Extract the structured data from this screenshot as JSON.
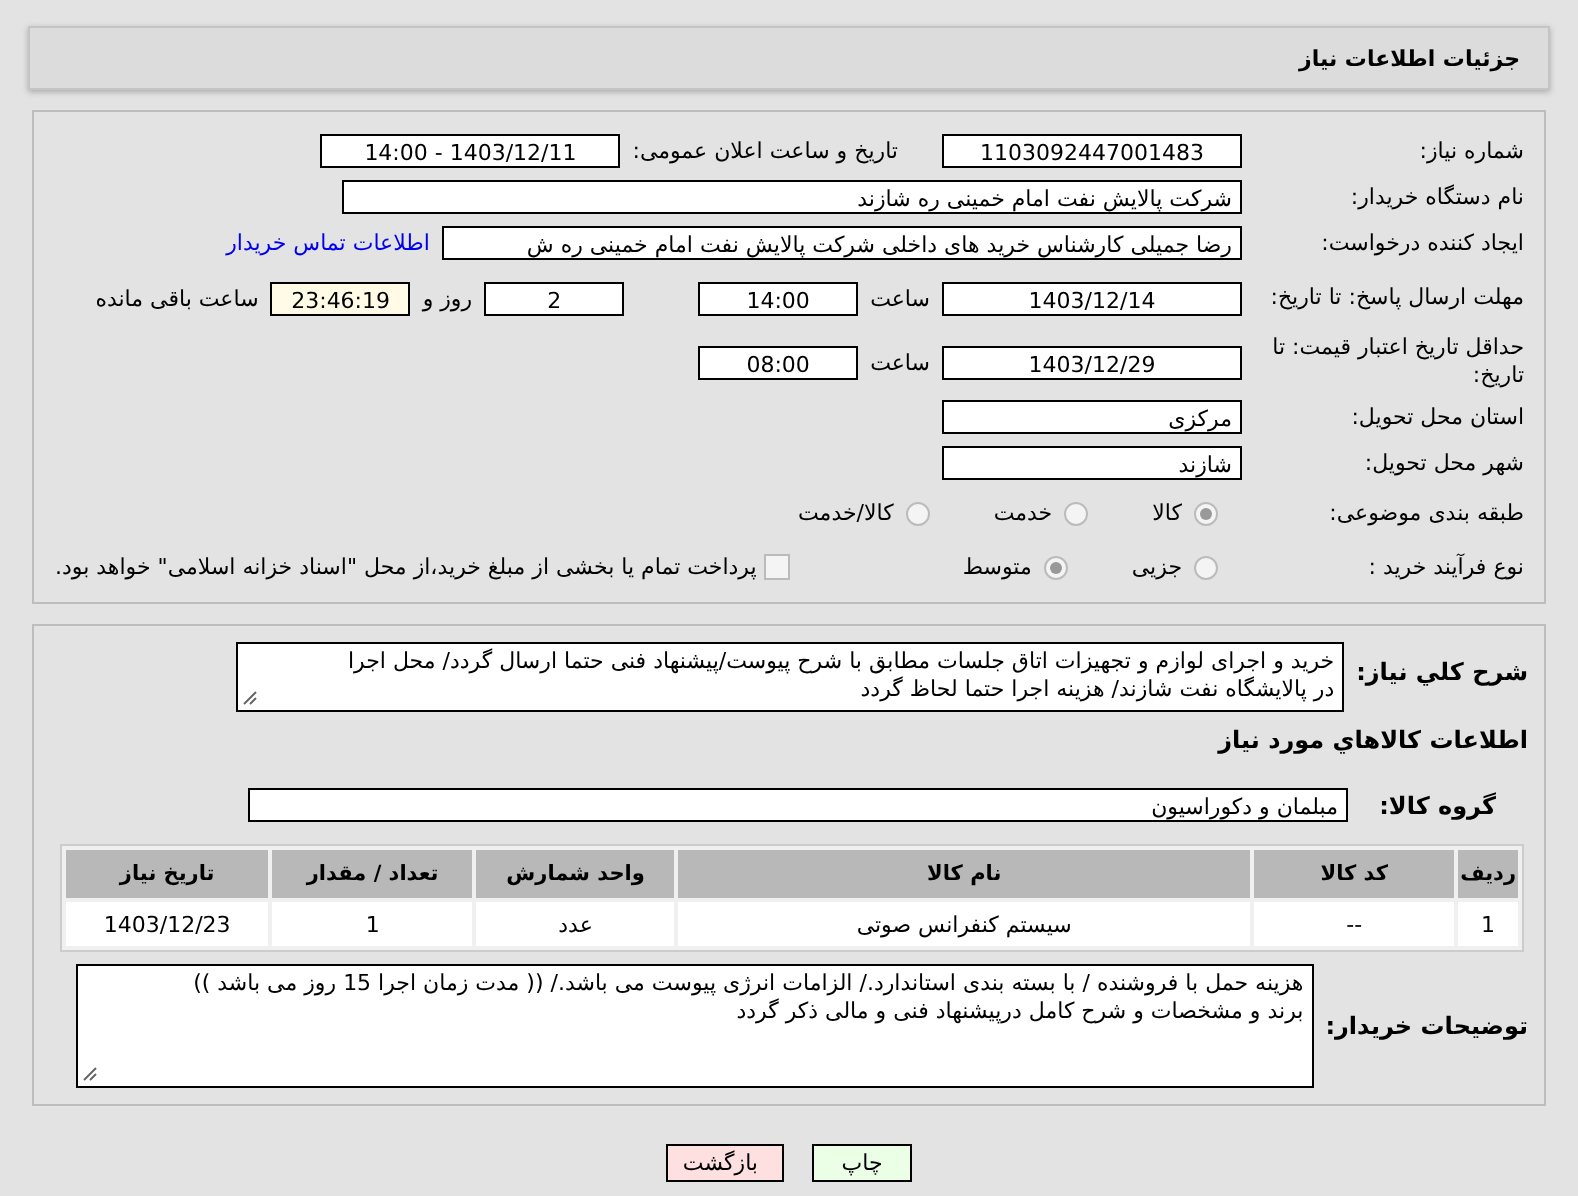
{
  "header": {
    "title": "جزئیات اطلاعات نیاز"
  },
  "need_number": {
    "label": "شماره نیاز:",
    "value": "1103092447001483"
  },
  "announce": {
    "label": "تاریخ و ساعت اعلان عمومی:",
    "value": "1403/12/11 - 14:00"
  },
  "buyer": {
    "label": "نام دستگاه خریدار:",
    "value": "شرکت پالایش نفت امام خمینی  ره  شازند"
  },
  "creator": {
    "label": "ایجاد کننده درخواست:",
    "value": "رضا جمیلی کارشناس خرید های داخلی  شرکت پالایش نفت امام خمینی  ره  ش",
    "link": "اطلاعات تماس خریدار"
  },
  "deadline": {
    "label": "مهلت ارسال پاسخ: تا تاریخ:",
    "date": "1403/12/14",
    "time_label": "ساعت",
    "time": "14:00",
    "days": "2",
    "days_label": "روز و",
    "remaining": "23:46:19",
    "remaining_label": "ساعت باقی مانده"
  },
  "validity": {
    "label": "حداقل تاریخ اعتبار قیمت: تا تاریخ:",
    "date": "1403/12/29",
    "time_label": "ساعت",
    "time": "08:00"
  },
  "province": {
    "label": "استان محل تحویل:",
    "value": "مرکزی"
  },
  "city": {
    "label": "شهر محل تحویل:",
    "value": "شازند"
  },
  "category": {
    "label": "طبقه بندی موضوعی:",
    "options": [
      {
        "label": "کالا",
        "selected": true
      },
      {
        "label": "خدمت",
        "selected": false
      },
      {
        "label": "کالا/خدمت",
        "selected": false
      }
    ]
  },
  "process": {
    "label": "نوع فرآیند خرید :",
    "options": [
      {
        "label": "جزیی",
        "selected": false
      },
      {
        "label": "متوسط",
        "selected": true
      }
    ],
    "payment": {
      "label": "پرداخت تمام یا بخشی از مبلغ خرید،از محل \"اسناد خزانه اسلامی\" خواهد بود.",
      "checked": false
    }
  },
  "description": {
    "label": "شرح کلي نياز:",
    "lines": [
      "خرید و اجرای لوازم و تجهیزات اتاق جلسات مطابق با شرح پیوست/پیشنهاد فنی حتما ارسال گردد/ محل اجرا",
      "در پالایشگاه نفت شازند/ هزینه اجرا حتما لحاظ گردد"
    ]
  },
  "goods_title": "اطلاعات کالاهاي مورد نياز",
  "goods_group": {
    "label": "گروه کالا:",
    "value": "مبلمان و دکوراسیون"
  },
  "table": {
    "columns": [
      "ردیف",
      "کد کالا",
      "نام کالا",
      "واحد شمارش",
      "تعداد / مقدار",
      "تاریخ نیاز"
    ],
    "rows": [
      [
        "1",
        "--",
        "سیستم کنفرانس صوتی",
        "عدد",
        "1",
        "1403/12/23"
      ]
    ]
  },
  "notes": {
    "label": "توضیحات خریدار:",
    "lines": [
      "هزینه حمل با فروشنده / با بسته بندی استاندارد./ الزامات انرژی پیوست می باشد./ (( مدت زمان اجرا 15 روز می باشد ))",
      "برند و مشخصات و شرح کامل درپیشنهاد فنی و مالی ذکر گردد"
    ]
  },
  "buttons": [
    {
      "label": "چاپ",
      "kind": "print"
    },
    {
      "label": "بازگشت",
      "kind": "back"
    }
  ]
}
